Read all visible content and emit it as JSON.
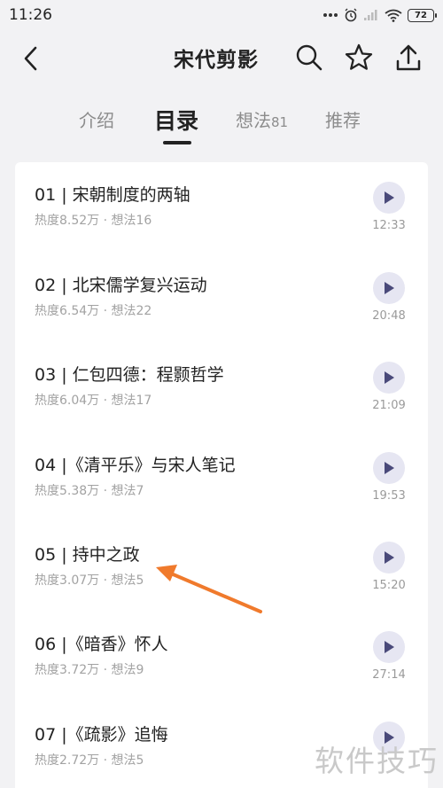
{
  "status_bar": {
    "time": "11:26",
    "battery": "72",
    "icons": [
      "more-dots-icon",
      "alarm-icon",
      "signal-icon",
      "wifi-icon",
      "battery-icon"
    ]
  },
  "header": {
    "title": "宋代剪影",
    "icons": [
      "back-icon",
      "search-icon",
      "star-icon",
      "share-icon"
    ]
  },
  "tabs": [
    {
      "label": "介绍"
    },
    {
      "label": "目录",
      "active": true
    },
    {
      "label": "想法",
      "count": "81"
    },
    {
      "label": "推荐"
    }
  ],
  "items": [
    {
      "title": "01 | 宋朝制度的两轴",
      "meta": "热度8.52万 · 想法16",
      "duration": "12:33"
    },
    {
      "title": "02 | 北宋儒学复兴运动",
      "meta": "热度6.54万 · 想法22",
      "duration": "20:48"
    },
    {
      "title": "03 | 仁包四德：程颢哲学",
      "meta": "热度6.04万 · 想法17",
      "duration": "21:09"
    },
    {
      "title": "04 |《清平乐》与宋人笔记",
      "meta": "热度5.38万 · 想法7",
      "duration": "19:53"
    },
    {
      "title": "05 | 持中之政",
      "meta": "热度3.07万 · 想法5",
      "duration": "15:20"
    },
    {
      "title": "06 |《暗香》怀人",
      "meta": "热度3.72万 · 想法9",
      "duration": "27:14"
    },
    {
      "title": "07 |《疏影》追悔",
      "meta": "热度2.72万 · 想法5",
      "duration": ""
    }
  ],
  "watermark": "软件技巧",
  "colors": {
    "accent_arrow": "#f07a2c",
    "play_bg": "#e6e6f2",
    "play_icon": "#4a4a7a"
  }
}
